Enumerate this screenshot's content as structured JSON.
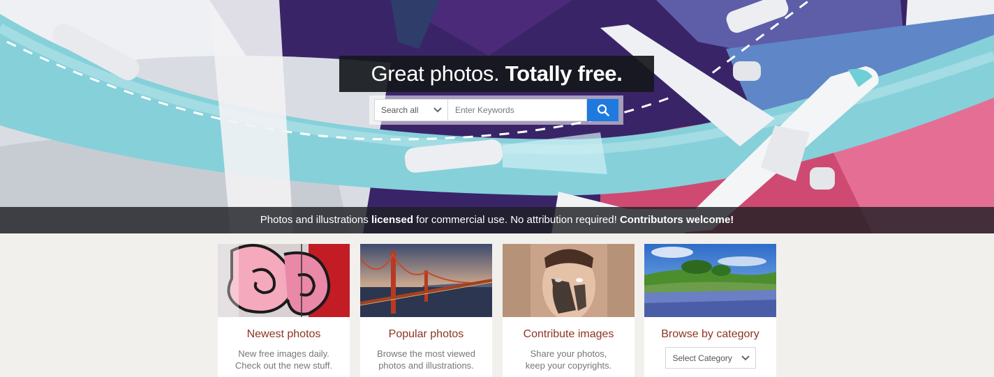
{
  "hero": {
    "headline_regular": "Great photos.",
    "headline_bold": "Totally free.",
    "search": {
      "scope_label": "Search all",
      "placeholder": "Enter Keywords"
    },
    "banner": {
      "part1": "Photos and illustrations ",
      "part2_bold": "licensed",
      "part3": " for commercial use. No attribution required! ",
      "part4_bold": "Contributors welcome!"
    }
  },
  "cards": [
    {
      "title": "Newest photos",
      "desc_line1": "New free images daily.",
      "desc_line2": "Check out the new stuff."
    },
    {
      "title": "Popular photos",
      "desc_line1": "Browse the most viewed",
      "desc_line2": "photos and illustrations."
    },
    {
      "title": "Contribute images",
      "desc_line1": "Share your photos,",
      "desc_line2": "keep your copyrights."
    },
    {
      "title": "Browse by category",
      "select_label": "Select Category"
    }
  ],
  "colors": {
    "accent_blue": "#1f7ae0",
    "card_title": "#8c3522",
    "page_bg": "#f2f0ec"
  },
  "icons": [
    "search-icon",
    "chevron-down-icon"
  ]
}
